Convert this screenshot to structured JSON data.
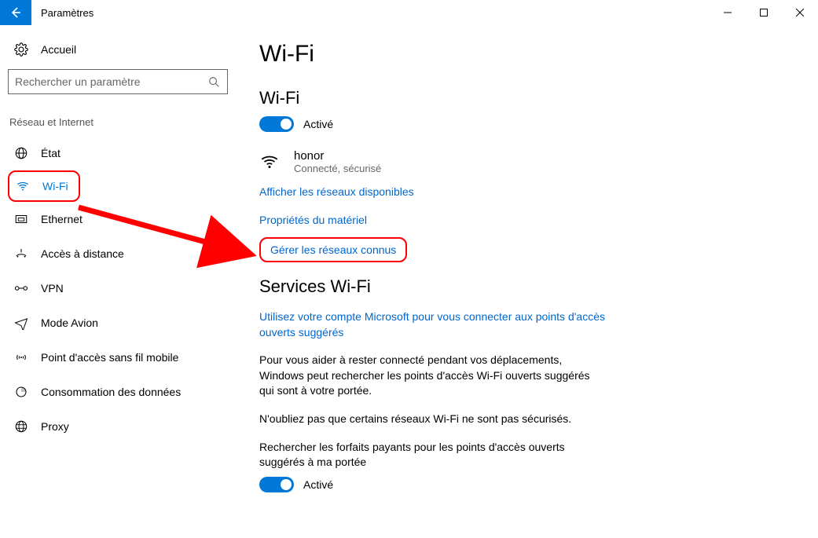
{
  "titlebar": {
    "title": "Paramètres"
  },
  "sidebar": {
    "home": "Accueil",
    "search_placeholder": "Rechercher un paramètre",
    "section": "Réseau et Internet",
    "items": [
      {
        "label": "État"
      },
      {
        "label": "Wi-Fi"
      },
      {
        "label": "Ethernet"
      },
      {
        "label": "Accès à distance"
      },
      {
        "label": "VPN"
      },
      {
        "label": "Mode Avion"
      },
      {
        "label": "Point d'accès sans fil mobile"
      },
      {
        "label": "Consommation des données"
      },
      {
        "label": "Proxy"
      }
    ]
  },
  "main": {
    "page_title": "Wi-Fi",
    "wifi_section": {
      "heading": "Wi-Fi",
      "toggle_state": "Activé"
    },
    "network": {
      "name": "honor",
      "status": "Connecté, sécurisé"
    },
    "links": {
      "show_networks": "Afficher les réseaux disponibles",
      "hardware_props": "Propriétés du matériel",
      "manage_known": "Gérer les réseaux connus"
    },
    "services": {
      "heading": "Services Wi-Fi",
      "ms_link": "Utilisez votre compte Microsoft pour vous connecter aux points d'accès ouverts suggérés",
      "para1": "Pour vous aider à rester connecté pendant vos déplacements, Windows peut rechercher les points d'accès Wi-Fi ouverts suggérés qui sont à votre portée.",
      "para2": "N'oubliez pas que certains réseaux Wi-Fi ne sont pas sécurisés.",
      "para3": "Rechercher les forfaits payants pour les points d'accès ouverts suggérés à ma portée",
      "toggle_state": "Activé"
    }
  }
}
